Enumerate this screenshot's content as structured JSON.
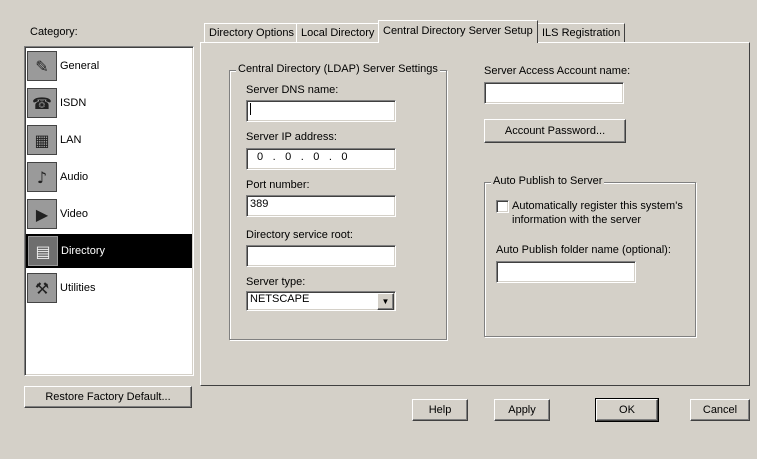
{
  "category": {
    "label": "Category:",
    "items": [
      {
        "label": "General",
        "icon": "general-icon",
        "glyph": "✎",
        "selected": false
      },
      {
        "label": "ISDN",
        "icon": "isdn-icon",
        "glyph": "☎",
        "selected": false
      },
      {
        "label": "LAN",
        "icon": "lan-icon",
        "glyph": "▦",
        "selected": false
      },
      {
        "label": "Audio",
        "icon": "audio-icon",
        "glyph": "♪",
        "selected": false
      },
      {
        "label": "Video",
        "icon": "video-icon",
        "glyph": "▶",
        "selected": false
      },
      {
        "label": "Directory",
        "icon": "directory-icon",
        "glyph": "▤",
        "selected": true
      },
      {
        "label": "Utilities",
        "icon": "utilities-icon",
        "glyph": "⚒",
        "selected": false
      }
    ]
  },
  "restore_button": "Restore Factory Default...",
  "tabs": [
    {
      "label": "Directory Options",
      "active": false
    },
    {
      "label": "Local Directory",
      "active": false
    },
    {
      "label": "Central Directory Server Setup",
      "active": true
    },
    {
      "label": "ILS Registration",
      "active": false
    }
  ],
  "ldap": {
    "title": "Central Directory (LDAP) Server Settings",
    "dns_label": "Server DNS name:",
    "dns_value": "",
    "ip_label": "Server IP address:",
    "ip_octets": [
      "0",
      "0",
      "0",
      "0"
    ],
    "ip_sep": ".",
    "port_label": "Port number:",
    "port_value": "389",
    "root_label": "Directory service root:",
    "root_value": "",
    "type_label": "Server type:",
    "type_value": "NETSCAPE"
  },
  "account": {
    "name_label": "Server Access Account name:",
    "name_value": "",
    "password_button": "Account Password..."
  },
  "auto_publish": {
    "title": "Auto Publish to Server",
    "checkbox_label_line1": "Automatically register this system's",
    "checkbox_label_line2": "information with the server",
    "checked": false,
    "folder_label": "Auto Publish folder name (optional):",
    "folder_value": ""
  },
  "footer": {
    "help": "Help",
    "apply": "Apply",
    "ok": "OK",
    "cancel": "Cancel"
  }
}
